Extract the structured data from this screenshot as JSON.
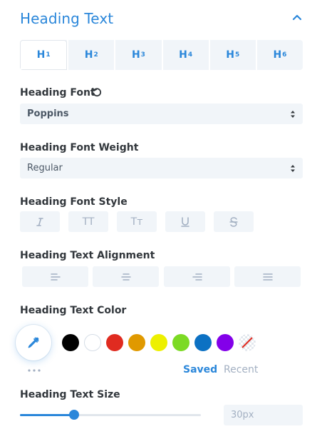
{
  "header": {
    "title": "Heading Text",
    "collapse_icon": "chevron-up-icon"
  },
  "tabs": [
    {
      "label": "H",
      "sub": "1",
      "active": true
    },
    {
      "label": "H",
      "sub": "2",
      "active": false
    },
    {
      "label": "H",
      "sub": "3",
      "active": false
    },
    {
      "label": "H",
      "sub": "4",
      "active": false
    },
    {
      "label": "H",
      "sub": "5",
      "active": false
    },
    {
      "label": "H",
      "sub": "6",
      "active": false
    }
  ],
  "font": {
    "label": "Heading Font",
    "value": "Poppins",
    "reset_icon": "reset-icon"
  },
  "weight": {
    "label": "Heading Font Weight",
    "value": "Regular"
  },
  "style": {
    "label": "Heading Font Style",
    "buttons": [
      {
        "name": "italic",
        "glyph": "I"
      },
      {
        "name": "uppercase",
        "glyph": "TT"
      },
      {
        "name": "capitalize",
        "glyph": "Tт"
      },
      {
        "name": "underline",
        "glyph": "U"
      },
      {
        "name": "strikethrough",
        "glyph": "S"
      }
    ]
  },
  "alignment": {
    "label": "Heading Text Alignment",
    "options": [
      "left",
      "center",
      "right",
      "justify"
    ]
  },
  "color": {
    "label": "Heading Text Color",
    "picker_icon": "eyedropper-icon",
    "swatches": [
      "#000000",
      "#ffffff",
      "#e02b20",
      "#e09900",
      "#edf000",
      "#7cda24",
      "#0c71c3",
      "#8300e9",
      "none"
    ],
    "saved_label": "Saved",
    "recent_label": "Recent"
  },
  "size": {
    "label": "Heading Text Size",
    "value": "30px",
    "slider_fraction": 0.3
  },
  "colors": {
    "accent": "#2b87da",
    "field_bg": "#f1f5f9",
    "muted": "#a3b0c2"
  }
}
